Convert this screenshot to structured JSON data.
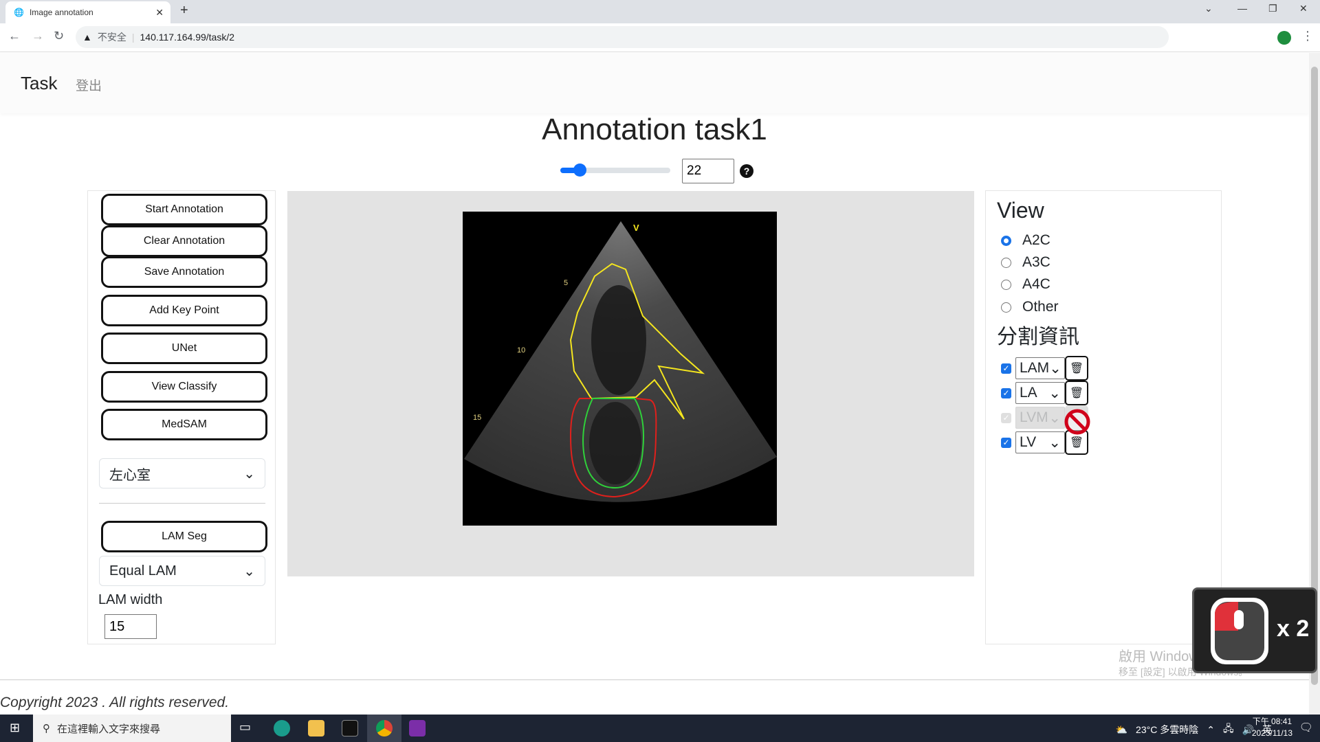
{
  "browser": {
    "tab_title": "Image annotation",
    "security_label": "不安全",
    "url": "140.117.164.99/task/2"
  },
  "navbar": {
    "brand": "Task",
    "logout": "登出"
  },
  "page": {
    "title": "Annotation task1",
    "frame_value": "22",
    "frame_slider_fraction": 0.13,
    "help": "?"
  },
  "left": {
    "buttons": [
      "Start Annotation",
      "Clear Annotation",
      "Save Annotation",
      "Add Key Point",
      "UNet",
      "View Classify",
      "MedSAM"
    ],
    "chamber_select": "左心室",
    "lam_seg": "LAM Seg",
    "lam_mode_select": "Equal LAM",
    "lam_width_label": "LAM width",
    "lam_width_value": "15"
  },
  "right": {
    "view_heading": "View",
    "views": [
      {
        "label": "A2C",
        "checked": true
      },
      {
        "label": "A3C",
        "checked": false
      },
      {
        "label": "A4C",
        "checked": false
      },
      {
        "label": "Other",
        "checked": false
      }
    ],
    "seg_heading": "分割資訊",
    "segments": [
      {
        "label": "LAM",
        "checked": true,
        "disabled": false
      },
      {
        "label": "LA",
        "checked": true,
        "disabled": false
      },
      {
        "label": "LVM",
        "checked": true,
        "disabled": true
      },
      {
        "label": "LV",
        "checked": true,
        "disabled": false
      }
    ]
  },
  "echo": {
    "depth_labels": [
      "5",
      "10",
      "15"
    ],
    "marker": "V",
    "colors": {
      "la": "#f5e61e",
      "lvm": "#e0201c",
      "lv": "#2fd13a"
    }
  },
  "footer": {
    "copyright": "Copyright 2023 . All rights reserved."
  },
  "watermark": {
    "line1": "啟用 Windows",
    "line2": "移至 [設定] 以啟用 Windows。"
  },
  "overlay": {
    "click_count": "x 2"
  },
  "taskbar": {
    "search_placeholder": "在這裡輸入文字來搜尋",
    "weather": "23°C  多雲時陰",
    "ime": "英",
    "time": "下午 08:41",
    "date": "2023/11/13"
  }
}
